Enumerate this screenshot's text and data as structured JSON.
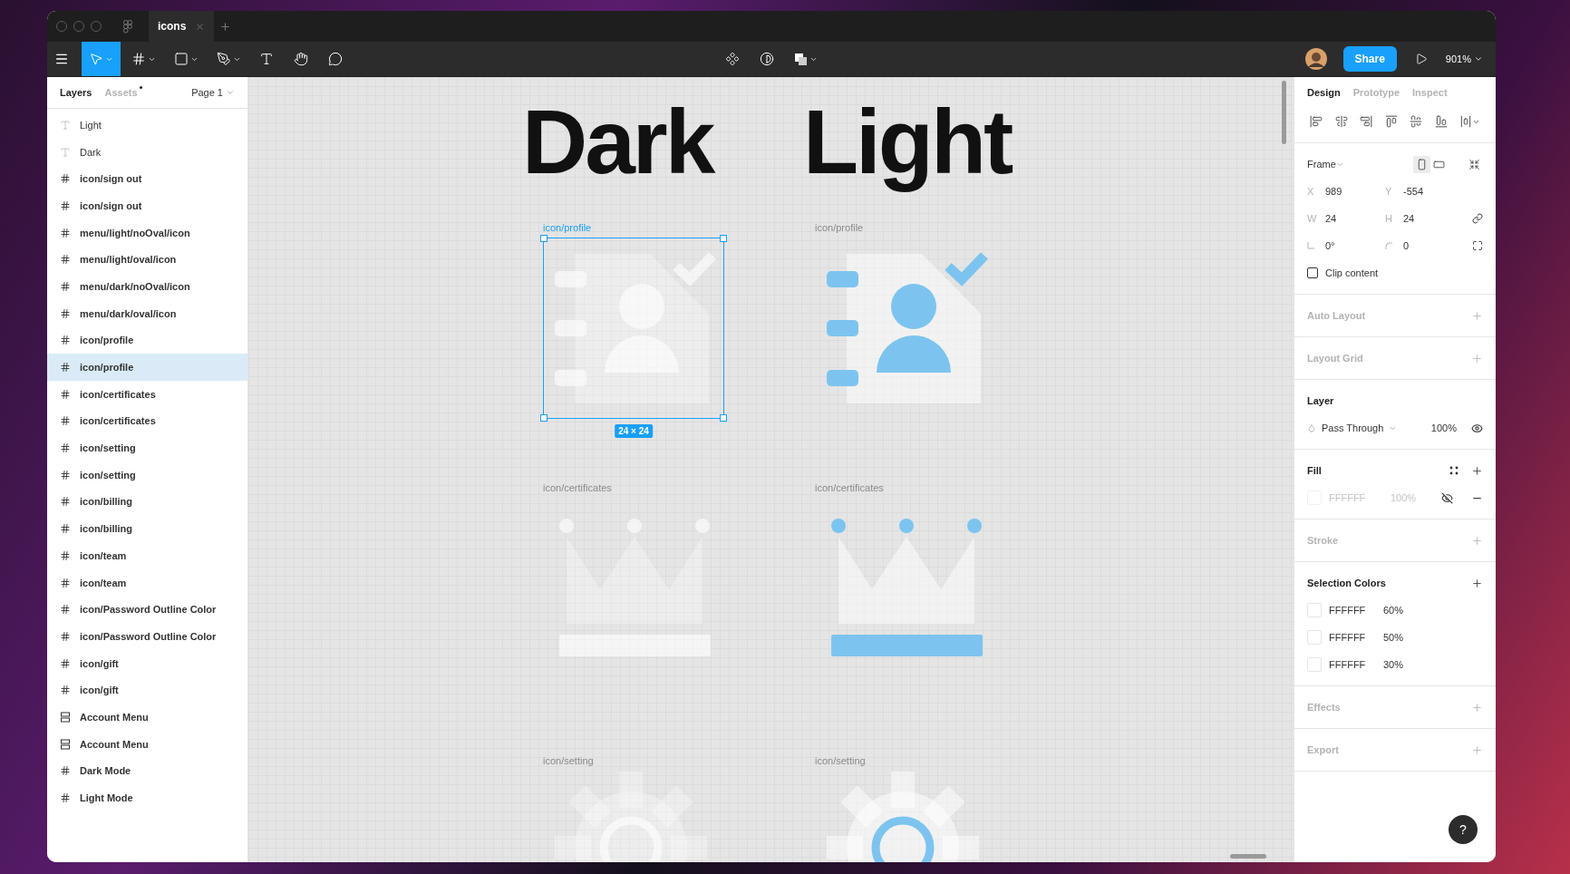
{
  "tabs_bar": {
    "tab": "icons"
  },
  "toolbar": {
    "tools": [
      {
        "kind": "move",
        "selected": true,
        "dropdown": true
      },
      {
        "kind": "frame",
        "selected": false,
        "dropdown": true
      },
      {
        "kind": "rectangle",
        "selected": false,
        "dropdown": true
      },
      {
        "kind": "pen",
        "selected": false,
        "dropdown": true
      },
      {
        "kind": "text",
        "selected": false,
        "dropdown": false
      },
      {
        "kind": "hand",
        "selected": false,
        "dropdown": false
      },
      {
        "kind": "comment",
        "selected": false,
        "dropdown": false
      }
    ],
    "share": "Share",
    "zoom": "901%"
  },
  "left_panel": {
    "tabs": [
      {
        "label": "Layers",
        "selected": true,
        "dot": false
      },
      {
        "label": "Assets",
        "selected": false,
        "dot": true
      }
    ],
    "page": "Page 1",
    "layers": [
      {
        "name": "Light",
        "kind": "text",
        "selected": false
      },
      {
        "name": "Dark",
        "kind": "text",
        "selected": false
      },
      {
        "name": "icon/sign out",
        "kind": "frame",
        "selected": false
      },
      {
        "name": "icon/sign out",
        "kind": "frame",
        "selected": false
      },
      {
        "name": "menu/light/noOval/icon",
        "kind": "frame",
        "selected": false
      },
      {
        "name": "menu/light/oval/icon",
        "kind": "frame",
        "selected": false
      },
      {
        "name": "menu/dark/noOval/icon",
        "kind": "frame",
        "selected": false
      },
      {
        "name": "menu/dark/oval/icon",
        "kind": "frame",
        "selected": false
      },
      {
        "name": "icon/profile",
        "kind": "frame",
        "selected": false
      },
      {
        "name": "icon/profile",
        "kind": "frame",
        "selected": true
      },
      {
        "name": "icon/certificates",
        "kind": "frame",
        "selected": false
      },
      {
        "name": "icon/certificates",
        "kind": "frame",
        "selected": false
      },
      {
        "name": "icon/setting",
        "kind": "frame",
        "selected": false
      },
      {
        "name": "icon/setting",
        "kind": "frame",
        "selected": false
      },
      {
        "name": "icon/billing",
        "kind": "frame",
        "selected": false
      },
      {
        "name": "icon/billing",
        "kind": "frame",
        "selected": false
      },
      {
        "name": "icon/team",
        "kind": "frame",
        "selected": false
      },
      {
        "name": "icon/team",
        "kind": "frame",
        "selected": false
      },
      {
        "name": "icon/Password Outline Color",
        "kind": "frame",
        "selected": false
      },
      {
        "name": "icon/Password Outline Color",
        "kind": "frame",
        "selected": false
      },
      {
        "name": "icon/gift",
        "kind": "frame",
        "selected": false
      },
      {
        "name": "icon/gift",
        "kind": "frame",
        "selected": false
      },
      {
        "name": "Account Menu",
        "kind": "component",
        "selected": false
      },
      {
        "name": "Account Menu",
        "kind": "component",
        "selected": false
      },
      {
        "name": "Dark Mode",
        "kind": "frame",
        "selected": false
      },
      {
        "name": "Light Mode",
        "kind": "frame",
        "selected": false
      }
    ]
  },
  "canvas": {
    "headings": [
      "Dark",
      "Light"
    ],
    "frames": [
      {
        "label": "icon/profile",
        "selected": true
      },
      {
        "label": "icon/profile",
        "selected": false
      },
      {
        "label": "icon/certificates",
        "selected": false
      },
      {
        "label": "icon/certificates",
        "selected": false
      },
      {
        "label": "icon/setting",
        "selected": false
      },
      {
        "label": "icon/setting",
        "selected": false
      }
    ],
    "selection_size": "24 × 24"
  },
  "right_panel": {
    "tabs": [
      {
        "label": "Design",
        "selected": true
      },
      {
        "label": "Prototype",
        "selected": false
      },
      {
        "label": "Inspect",
        "selected": false
      }
    ],
    "frame": {
      "label": "Frame",
      "orientations": [
        {
          "kind": "portrait",
          "selected": true
        },
        {
          "kind": "landscape",
          "selected": false
        }
      ],
      "fields": [
        {
          "kind": "text",
          "label": "X",
          "value": "989"
        },
        {
          "kind": "text",
          "label": "Y",
          "value": "-554"
        },
        {
          "kind": "text",
          "label": "W",
          "value": "24"
        },
        {
          "kind": "text",
          "label": "H",
          "value": "24"
        },
        {
          "kind": "rotation",
          "value": "0°"
        },
        {
          "kind": "radius",
          "value": "0"
        }
      ],
      "clip": {
        "label": "Clip content",
        "checked": false
      }
    },
    "sections": [
      {
        "kind": "empty",
        "title": "Auto Layout"
      },
      {
        "kind": "empty",
        "title": "Layout Grid"
      },
      {
        "kind": "layer",
        "title": "Layer",
        "blend": "Pass Through",
        "opacity": "100%",
        "visible": true
      },
      {
        "kind": "fill",
        "title": "Fill",
        "hex": "FFFFFF",
        "opacity": "100%",
        "hidden": true
      },
      {
        "kind": "empty",
        "title": "Stroke"
      },
      {
        "kind": "colors",
        "title": "Selection Colors",
        "colors": [
          {
            "hex": "FFFFFF",
            "opacity": "60%"
          },
          {
            "hex": "FFFFFF",
            "opacity": "50%"
          },
          {
            "hex": "FFFFFF",
            "opacity": "30%"
          }
        ]
      },
      {
        "kind": "empty",
        "title": "Effects"
      },
      {
        "kind": "empty",
        "title": "Export"
      }
    ]
  },
  "help": "?"
}
